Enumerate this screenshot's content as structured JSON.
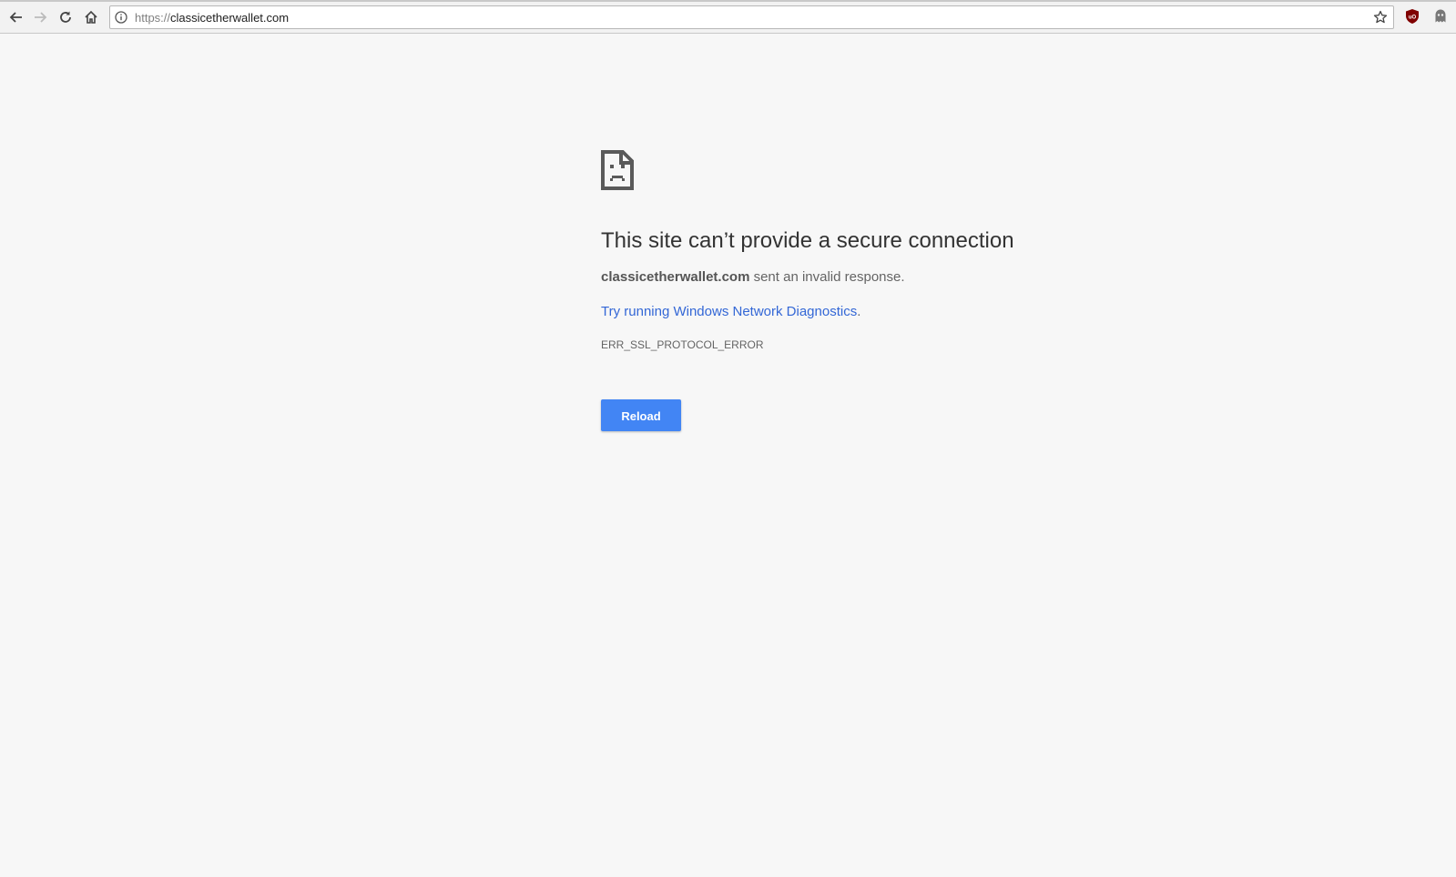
{
  "browser": {
    "url_scheme": "https://",
    "url_host": "classicetherwallet.com",
    "nav_icons": [
      "back-arrow-icon",
      "forward-arrow-icon",
      "reload-icon",
      "home-icon"
    ],
    "extensions": [
      "ublock-origin-icon",
      "ghostery-icon"
    ]
  },
  "error_page": {
    "title": "This site can’t provide a secure connection",
    "host": "classicetherwallet.com",
    "summary_suffix": " sent an invalid response.",
    "diagnostics_link": "Try running Windows Network Diagnostics",
    "diagnostics_period": ".",
    "error_code": "ERR_SSL_PROTOCOL_ERROR",
    "reload_label": "Reload"
  },
  "colors": {
    "page_bg": "#f7f7f7",
    "link": "#3367d6",
    "button": "#4285f4"
  }
}
